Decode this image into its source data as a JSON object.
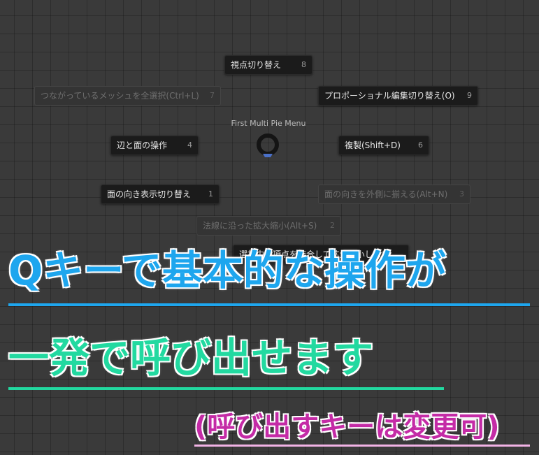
{
  "pie_menu": {
    "title": "First Multi Pie Menu",
    "items": [
      {
        "label": "視点切り替え",
        "key": "8",
        "enabled": true
      },
      {
        "label": "つながっているメッシュを全選択(Ctrl+L)",
        "key": "7",
        "enabled": false
      },
      {
        "label": "プロポーショナル編集切り替え(O)",
        "key": "9",
        "enabled": true
      },
      {
        "label": "辺と面の操作",
        "key": "4",
        "enabled": true
      },
      {
        "label": "複製(Shift+D)",
        "key": "6",
        "enabled": true
      },
      {
        "label": "面の向き表示切り替え",
        "key": "1",
        "enabled": true
      },
      {
        "label": "面の向きを外側に揃える(Alt+N)",
        "key": "3",
        "enabled": false
      },
      {
        "label": "法線に沿った拡大縮小(Alt+S)",
        "key": "2",
        "enabled": false
      },
      {
        "label": "選択中の頂点を結合して拡大縮小します",
        "key": "",
        "enabled": true
      }
    ]
  },
  "overlay": {
    "line1": "Qキーで基本的な操作が",
    "line2": "一発で呼び出せます",
    "line3": "(呼び出すキーは変更可)",
    "colors": {
      "line1": "#1ea6ee",
      "line2": "#22d9a0",
      "line3": "#c42ba6"
    }
  }
}
